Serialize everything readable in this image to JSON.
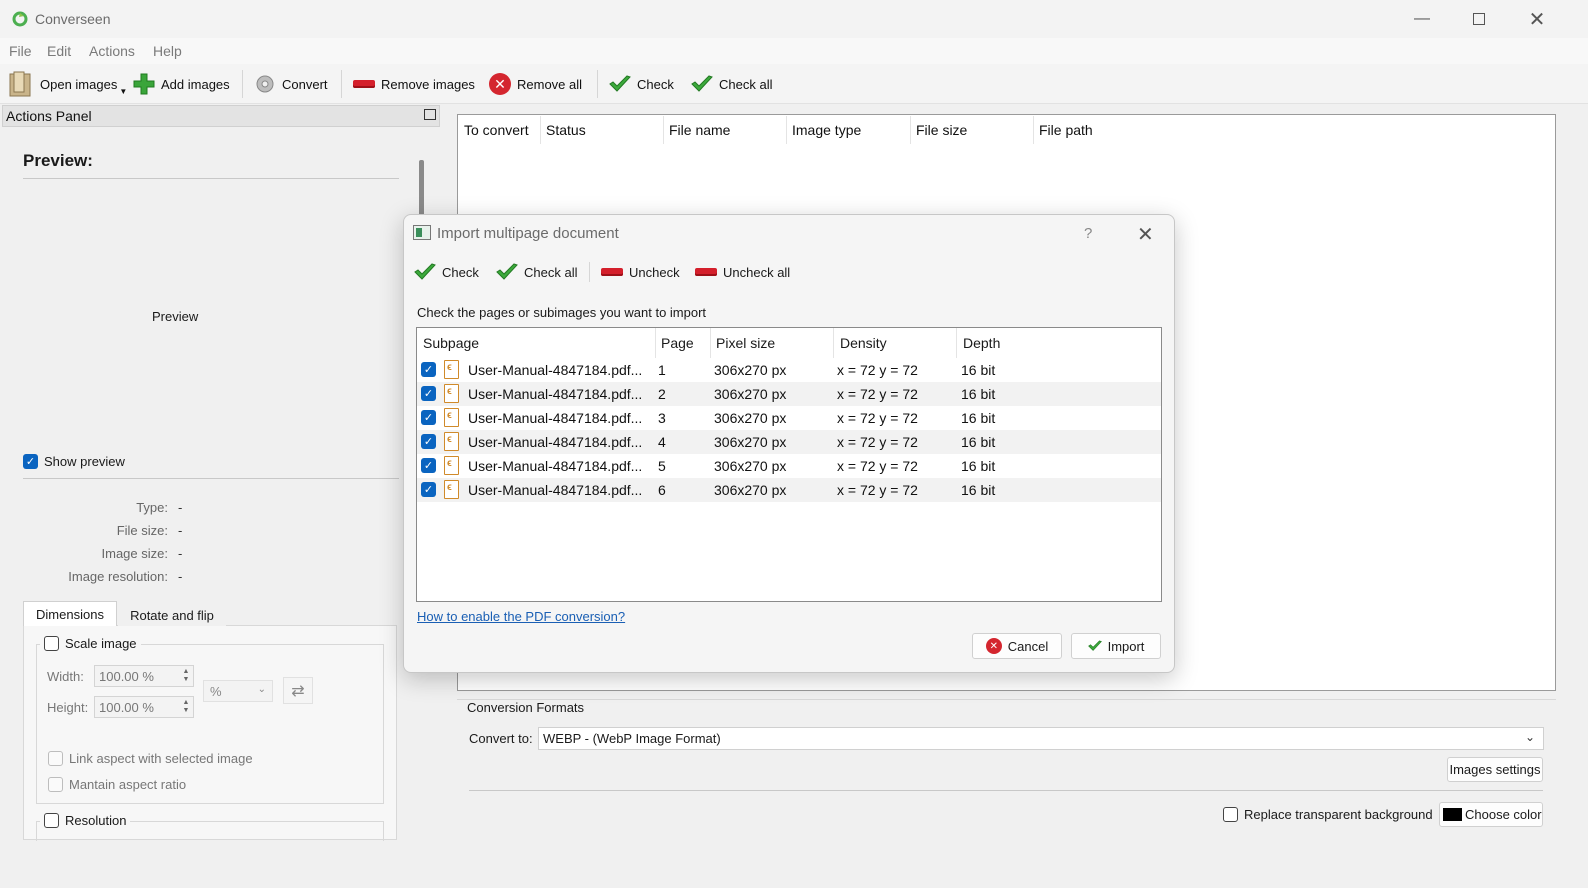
{
  "window": {
    "title": "Converseen"
  },
  "menu": [
    {
      "label": "File"
    },
    {
      "label": "Edit"
    },
    {
      "label": "Actions"
    },
    {
      "label": "Help"
    }
  ],
  "toolbar": {
    "open_images": "Open images",
    "add_images": "Add images",
    "convert": "Convert",
    "remove_images": "Remove images",
    "remove_all": "Remove all",
    "check": "Check",
    "check_all": "Check all"
  },
  "actions_panel": {
    "title": "Actions Panel",
    "preview_title": "Preview:",
    "preview_placeholder": "Preview",
    "show_preview": "Show preview",
    "show_preview_checked": true,
    "info": [
      {
        "label": "Type:",
        "value": "-"
      },
      {
        "label": "File size:",
        "value": "-"
      },
      {
        "label": "Image size:",
        "value": "-"
      },
      {
        "label": "Image resolution:",
        "value": "-"
      }
    ],
    "tabs": [
      "Dimensions",
      "Rotate and flip"
    ],
    "scale_image": "Scale image",
    "width_label": "Width:",
    "width_value": "100.00 %",
    "height_label": "Height:",
    "height_value": "100.00 %",
    "unit": "%",
    "link_aspect": "Link aspect with selected image",
    "maintain_aspect": "Mantain aspect ratio",
    "resolution": "Resolution"
  },
  "main_table": {
    "columns": [
      "To convert",
      "Status",
      "File name",
      "Image type",
      "File size",
      "File path"
    ]
  },
  "conversion": {
    "group_title": "Conversion Formats",
    "convert_to_label": "Convert to:",
    "format": "WEBP - (WebP Image Format)",
    "images_settings": "Images settings",
    "replace_bg": "Replace transparent background",
    "choose_color": "Choose color",
    "bg_color": "#000000"
  },
  "dialog": {
    "title": "Import multipage document",
    "help": "?",
    "toolbar": {
      "check": "Check",
      "check_all": "Check all",
      "uncheck": "Uncheck",
      "uncheck_all": "Uncheck all"
    },
    "instruction": "Check the pages or subimages you want to import",
    "columns": [
      "Subpage",
      "Page",
      "Pixel size",
      "Density",
      "Depth"
    ],
    "rows": [
      {
        "name": "User-Manual-4847184.pdf...",
        "page": "1",
        "size": "306x270 px",
        "density": "x = 72 y = 72",
        "depth": "16 bit"
      },
      {
        "name": "User-Manual-4847184.pdf...",
        "page": "2",
        "size": "306x270 px",
        "density": "x = 72 y = 72",
        "depth": "16 bit"
      },
      {
        "name": "User-Manual-4847184.pdf...",
        "page": "3",
        "size": "306x270 px",
        "density": "x = 72 y = 72",
        "depth": "16 bit"
      },
      {
        "name": "User-Manual-4847184.pdf...",
        "page": "4",
        "size": "306x270 px",
        "density": "x = 72 y = 72",
        "depth": "16 bit"
      },
      {
        "name": "User-Manual-4847184.pdf...",
        "page": "5",
        "size": "306x270 px",
        "density": "x = 72 y = 72",
        "depth": "16 bit"
      },
      {
        "name": "User-Manual-4847184.pdf...",
        "page": "6",
        "size": "306x270 px",
        "density": "x = 72 y = 72",
        "depth": "16 bit"
      }
    ],
    "link": "How to enable the PDF conversion?",
    "cancel": "Cancel",
    "import": "Import"
  }
}
